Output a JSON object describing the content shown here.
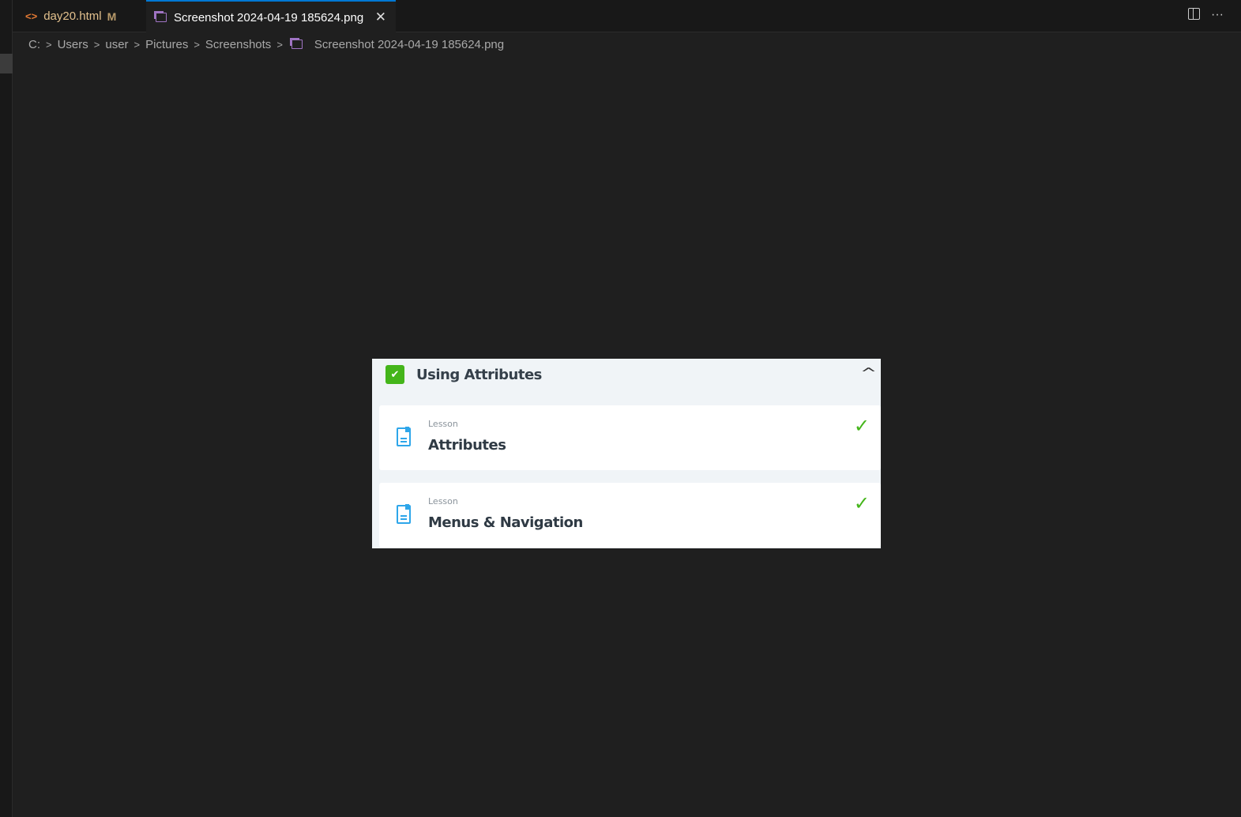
{
  "tabs": [
    {
      "label": "day20.html",
      "badge": "M"
    },
    {
      "label": "Screenshot 2024-04-19 185624.png",
      "close": "✕"
    }
  ],
  "actions": {
    "more": "···"
  },
  "breadcrumb": [
    "C:",
    "Users",
    "user",
    "Pictures",
    "Screenshots",
    "Screenshot 2024-04-19 185624.png"
  ],
  "preview": {
    "section_title": "Using Attributes",
    "lessons": [
      {
        "type": "Lesson",
        "title": "Attributes"
      },
      {
        "type": "Lesson",
        "title": "Menus & Navigation"
      }
    ]
  }
}
